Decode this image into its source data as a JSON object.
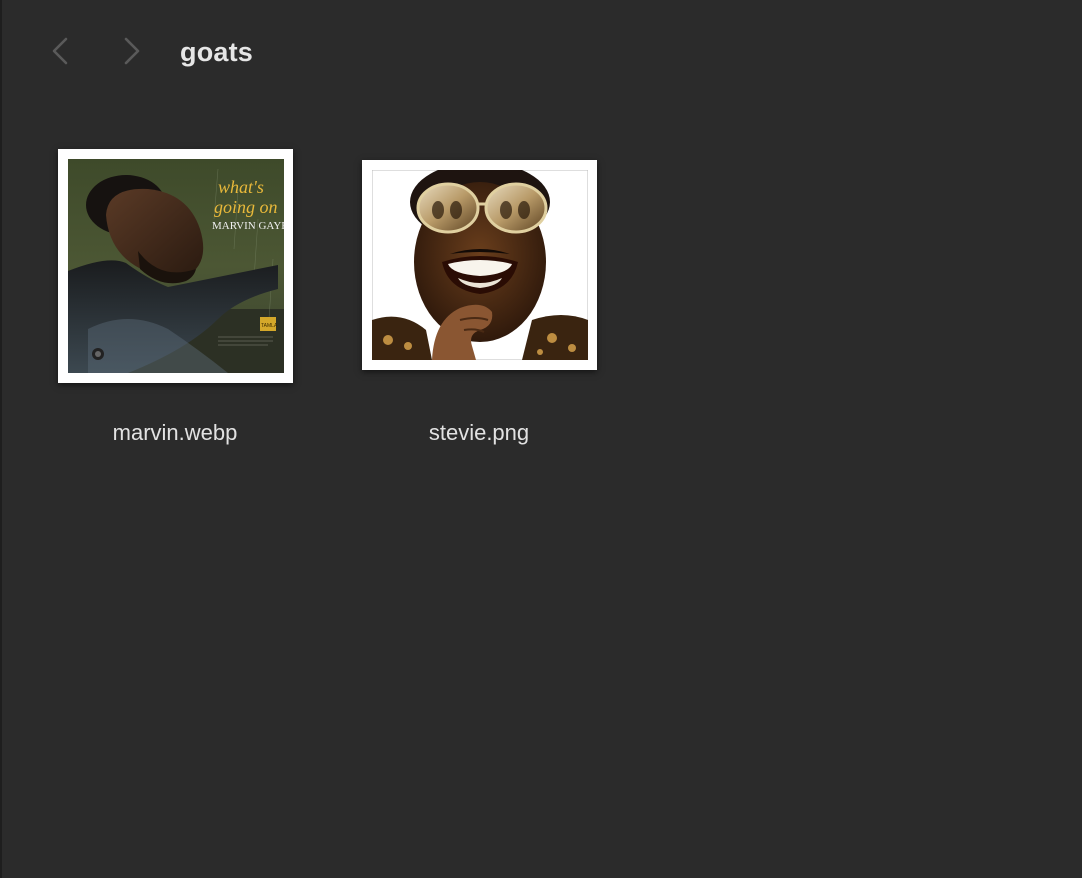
{
  "window": {
    "folder_title": "goats"
  },
  "toolbar": {
    "back_icon": "chevron-left-icon",
    "forward_icon": "chevron-right-icon"
  },
  "files": [
    {
      "name": "marvin.webp",
      "thumbnail_text": {
        "title_line1": "what's",
        "title_line2": "going on",
        "artist": "MARVIN GAYE",
        "label": "TAMLA"
      }
    },
    {
      "name": "stevie.png"
    }
  ],
  "colors": {
    "background": "#2b2b2b",
    "text": "#e6e6e6",
    "nav_disabled": "#5a5a5a",
    "thumb_frame": "#ffffff",
    "marvin_title_yellow": "#e8b83a"
  }
}
